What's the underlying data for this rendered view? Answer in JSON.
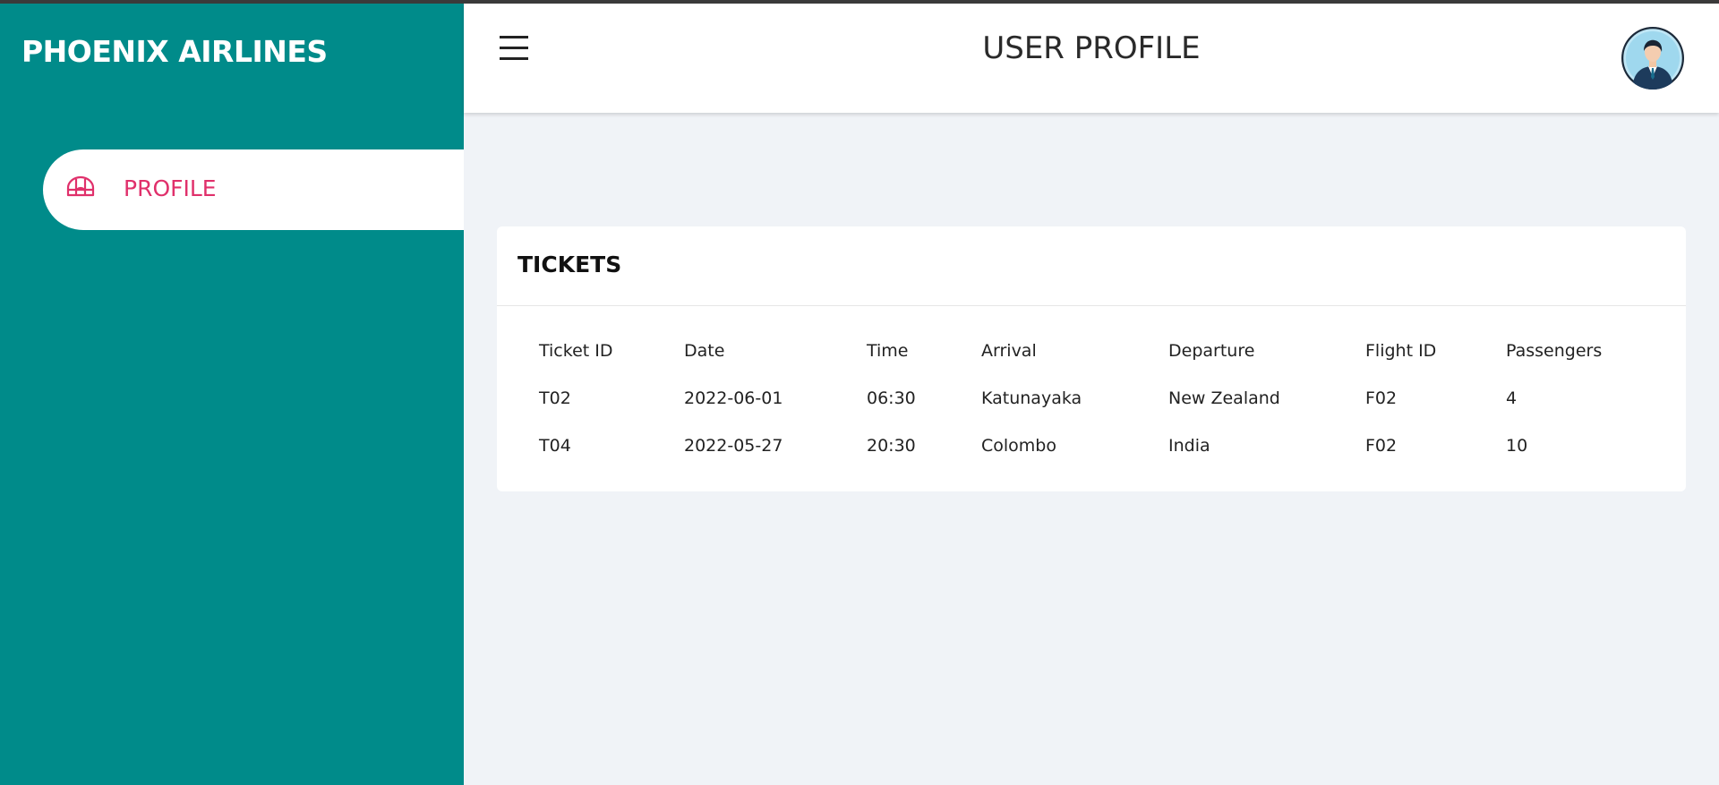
{
  "sidebar": {
    "brand": "PHOENIX AIRLINES",
    "items": [
      {
        "label": "PROFILE",
        "icon": "igloo-icon",
        "active": true
      }
    ]
  },
  "header": {
    "title": "USER PROFILE",
    "menu_icon": "hamburger-menu-icon",
    "avatar_icon": "user-avatar-icon"
  },
  "tickets": {
    "title": "TICKETS",
    "columns": [
      "Ticket ID",
      "Date",
      "Time",
      "Arrival",
      "Departure",
      "Flight ID",
      "Passengers"
    ],
    "rows": [
      [
        "T02",
        "2022-06-01",
        "06:30",
        "Katunayaka",
        "New Zealand",
        "F02",
        "4"
      ],
      [
        "T04",
        "2022-05-27",
        "20:30",
        "Colombo",
        "India",
        "F02",
        "10"
      ]
    ]
  },
  "colors": {
    "sidebar": "#008b8a",
    "accent": "#e0306b",
    "background": "#f0f3f7"
  }
}
